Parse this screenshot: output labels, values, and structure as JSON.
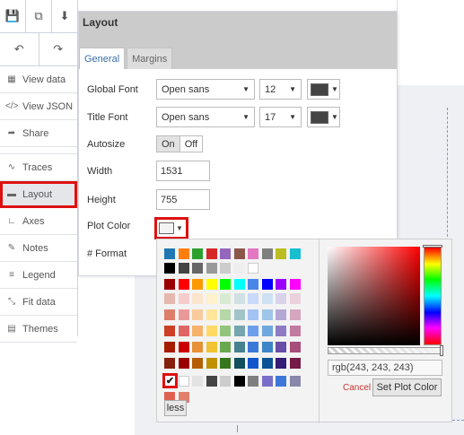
{
  "toolbar": {
    "row1": [
      {
        "icon": "save-icon",
        "glyph": "💾"
      },
      {
        "icon": "copy-icon",
        "glyph": "⧉"
      },
      {
        "icon": "download-icon",
        "glyph": "⬇"
      }
    ],
    "row2": [
      {
        "icon": "undo-icon",
        "glyph": "↶"
      },
      {
        "icon": "redo-icon",
        "glyph": "↷"
      }
    ]
  },
  "sidebar": {
    "items": [
      {
        "label": "View data",
        "icon": "table-icon",
        "glyph": "▦"
      },
      {
        "label": "View JSON",
        "icon": "code-icon",
        "glyph": "</>"
      },
      {
        "label": "Share",
        "icon": "share-icon",
        "glyph": "➦"
      },
      {
        "label": "Traces",
        "icon": "traces-icon",
        "glyph": "∿"
      },
      {
        "label": "Layout",
        "icon": "file-icon",
        "glyph": "▬",
        "active": true
      },
      {
        "label": "Axes",
        "icon": "axes-icon",
        "glyph": "∟"
      },
      {
        "label": "Notes",
        "icon": "pencil-icon",
        "glyph": "✎"
      },
      {
        "label": "Legend",
        "icon": "list-icon",
        "glyph": "≡"
      },
      {
        "label": "Fit data",
        "icon": "fit-icon",
        "glyph": "⤡"
      },
      {
        "label": "Themes",
        "icon": "themes-icon",
        "glyph": "▤"
      }
    ]
  },
  "panel": {
    "title": "Layout",
    "tabs": [
      "General",
      "Margins"
    ],
    "active_tab": "General",
    "global_font": {
      "label": "Global Font",
      "family": "Open sans",
      "size": "12",
      "color": "#444444"
    },
    "title_font": {
      "label": "Title Font",
      "family": "Open sans",
      "size": "17",
      "color": "#444444"
    },
    "autosize": {
      "label": "Autosize",
      "on": "On",
      "off": "Off"
    },
    "width": {
      "label": "Width",
      "value": "1531"
    },
    "height": {
      "label": "Height",
      "value": "755"
    },
    "plot_color": {
      "label": "Plot Color",
      "color": "#f3f3f3"
    },
    "number_format": {
      "label": "# Format"
    }
  },
  "picker": {
    "palette_rows": [
      [
        "#1f77b4",
        "#ff7f0e",
        "#2ca02c",
        "#d62728",
        "#9467bd",
        "#8c564b",
        "#e377c2",
        "#7f7f7f",
        "#bcbd22",
        "#17becf"
      ],
      [
        "#000000",
        "#444444",
        "#666666",
        "#999999",
        "#cccccc",
        "#eeeeee",
        "#ffffff"
      ],
      [
        "#990000",
        "#ff0000",
        "#ff9900",
        "#ffff00",
        "#00ff00",
        "#00ffff",
        "#4a86e8",
        "#0000ff",
        "#9900ff",
        "#ff00ff"
      ],
      [
        "#e6b8af",
        "#f4cccc",
        "#fce5cd",
        "#fff2cc",
        "#d9ead3",
        "#d0e0e3",
        "#c9daf8",
        "#cfe2f3",
        "#d9d2e9",
        "#ead1dc"
      ],
      [
        "#dd7e6b",
        "#ea9999",
        "#f9cb9c",
        "#ffe599",
        "#b6d7a8",
        "#a2c4c9",
        "#a4c2f4",
        "#9fc5e8",
        "#b4a7d6",
        "#d5a6bd"
      ],
      [
        "#cc4125",
        "#e06666",
        "#f6b26b",
        "#ffd966",
        "#93c47d",
        "#76a5af",
        "#6d9eeb",
        "#6fa8dc",
        "#8e7cc3",
        "#c27ba0"
      ],
      [
        "#a61c00",
        "#cc0000",
        "#e69138",
        "#f1c232",
        "#6aa84f",
        "#45818e",
        "#3c78d8",
        "#3d85c6",
        "#674ea7",
        "#a64d79"
      ],
      [
        "#85200c",
        "#990000",
        "#b45f06",
        "#bf9000",
        "#38761d",
        "#134f5c",
        "#1155cc",
        "#0b5394",
        "#351c75",
        "#741b47"
      ],
      [
        "#f3f3f3",
        "#ffffff",
        "#e3e3e3",
        "#444444",
        "#cccccc",
        "#000000",
        "#7f7f7f",
        "#7a6fc8",
        "#3c78d8",
        "#88a"
      ],
      [
        "#e06050",
        "#e0806a"
      ]
    ],
    "selected": "#f3f3f3",
    "check_glyph": "✔",
    "less_label": "less",
    "rgb_value": "rgb(243, 243, 243)",
    "cancel_label": "Cancel",
    "set_label": "Set Plot Color"
  }
}
